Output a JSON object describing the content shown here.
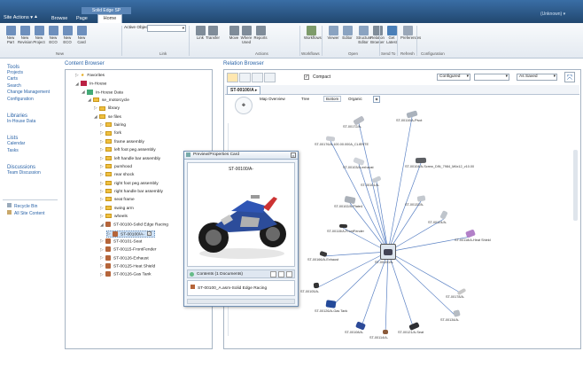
{
  "topbar": {
    "site_actions": "Site Actions ▾",
    "tabs": [
      "Browse",
      "Page",
      "Home"
    ],
    "context_tab": "Solid Edge SP",
    "user": "(Unknown) ▾"
  },
  "ribbon": {
    "buttons": [
      "New Part",
      "New Revision",
      "New Project",
      "New ECO",
      "New ECO",
      "New Card",
      "",
      "Link",
      "Transfer",
      "Move",
      "Where Used",
      "Reports",
      "",
      "Workflows",
      "Viewer",
      "Editor",
      "Structure Editor",
      "Relation Browser",
      "Get Latest",
      "Preferences"
    ],
    "active_object_label": "Active Object:",
    "groups": [
      "New",
      "Link",
      "Actions",
      "Workflows",
      "Open",
      "Send To",
      "Refresh",
      "Configuration"
    ]
  },
  "leftnav": {
    "sections": [
      {
        "title": "Tools",
        "items": [
          "Projects",
          "Carts",
          "Search",
          "Change Management",
          "Configuration"
        ]
      },
      {
        "title": "Libraries",
        "items": [
          "In-House Data"
        ]
      },
      {
        "title": "Lists",
        "items": [
          "Calendar",
          "Tasks"
        ]
      },
      {
        "title": "Discussions",
        "items": [
          "Team Discussion"
        ]
      }
    ],
    "bottom": [
      "Recycle Bin",
      "All Site Content"
    ]
  },
  "content_browser": {
    "title": "Content Browser",
    "tree": [
      {
        "d": 1,
        "t": "Favorites",
        "k": "star"
      },
      {
        "d": 1,
        "t": "In-House",
        "k": "house",
        "open": true
      },
      {
        "d": 2,
        "t": "In-House Data",
        "k": "lib",
        "open": true
      },
      {
        "d": 3,
        "t": "se_motorcycle",
        "k": "fold",
        "open": true
      },
      {
        "d": 4,
        "t": "library",
        "k": "fold"
      },
      {
        "d": 4,
        "t": "se files",
        "k": "fold",
        "open": true
      },
      {
        "d": 5,
        "t": "fairing",
        "k": "fold"
      },
      {
        "d": 5,
        "t": "fork",
        "k": "fold"
      },
      {
        "d": 5,
        "t": "frame assembly",
        "k": "fold"
      },
      {
        "d": 5,
        "t": "left foot peg assembly",
        "k": "fold"
      },
      {
        "d": 5,
        "t": "left handle bar assembly",
        "k": "fold"
      },
      {
        "d": 5,
        "t": "pumhood",
        "k": "fold"
      },
      {
        "d": 5,
        "t": "rear shock",
        "k": "fold"
      },
      {
        "d": 5,
        "t": "right foot peg assembly",
        "k": "fold"
      },
      {
        "d": 5,
        "t": "right handle bar assembly",
        "k": "fold"
      },
      {
        "d": 5,
        "t": "seat frame",
        "k": "fold"
      },
      {
        "d": 5,
        "t": "swing arm",
        "k": "fold"
      },
      {
        "d": 5,
        "t": "wheels",
        "k": "fold"
      },
      {
        "d": 5,
        "t": "ST-00100-Solid Edge Racing",
        "k": "part",
        "open": true
      },
      {
        "d": 6,
        "t": "ST-00100/A-",
        "k": "part",
        "sel": true
      },
      {
        "d": 5,
        "t": "ST-00101-Seat",
        "k": "part"
      },
      {
        "d": 5,
        "t": "ST-00115-FrontFender",
        "k": "part"
      },
      {
        "d": 5,
        "t": "ST-00126-Exhaust",
        "k": "part"
      },
      {
        "d": 5,
        "t": "ST-00125-Heat Shield",
        "k": "part"
      },
      {
        "d": 5,
        "t": "ST-00126-Gas Tank",
        "k": "part"
      }
    ]
  },
  "relation_browser": {
    "title": "Relation Browser",
    "compact": "Compact",
    "configured": "Configured",
    "as_saved": "As Saved",
    "active_tab": "ST-00100/A ▸",
    "view_tabs": [
      "Map Overview",
      "Tree",
      "Bottom",
      "Organic"
    ],
    "center_label": "ST-00100/A-",
    "nodes": [
      "ST-00172/A-",
      "ST-00176/A-100.00.000A_CLIENTE",
      "ST-00110/A-Pivot",
      "ST-00103/A-exhaust",
      "ST-00104/A-Screw_DIN_7984_M6x12_v10.00",
      "ST-00101/A-",
      "ST-00102/A-Plate4",
      "ST-00132/A-",
      "ST-00124/A-",
      "ST-00115/A-FrontFender",
      "ST-00118/A-Heat Shield",
      "ST-00166/A-Exhaust",
      "ST-00105/A-",
      "ST-00178/A-",
      "ST-00126/A-Gas Tank",
      "ST-00134/A-",
      "ST-00108/A-",
      "ST-00114/A-",
      "ST-00121/A-Seat"
    ]
  },
  "preview": {
    "title": "Preview/Properties Card",
    "part": "ST-00100/A-",
    "contents_title": "Contents (1 Documents)",
    "doc": "ST-00100_A.asm-Solid Edge Racing"
  },
  "colors": {
    "brand": "#2d5c8f",
    "link": "#2b64a8",
    "select": "#cfe2f6"
  }
}
